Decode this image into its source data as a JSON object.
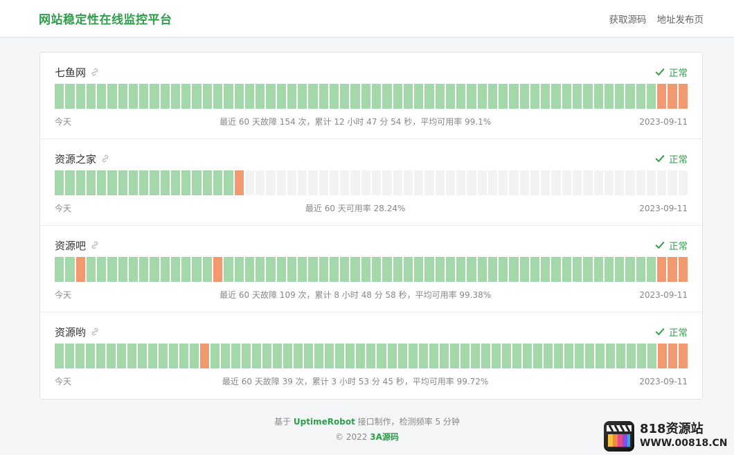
{
  "header": {
    "title": "网站稳定性在线监控平台",
    "nav": [
      "获取源码",
      "地址发布页"
    ]
  },
  "colors": {
    "brand": "#2e9e4a",
    "up": "#a3d8ab",
    "down": "#f2996f",
    "none": "#f2f2f2"
  },
  "monitors": [
    {
      "name": "七鱼网",
      "status": "正常",
      "left_label": "今天",
      "summary": "最近 60 天故障 154 次，累计 12 小时 47 分 54 秒，平均可用率 99.1%",
      "date": "2023-09-11",
      "bars": "uuuuuuuuuuuuuuuuuuuuuuuuuuuuuuuuuuuuuuuuuuuuuuuuuuuuuuuuuddd"
    },
    {
      "name": "资源之家",
      "status": "正常",
      "left_label": "今天",
      "summary": "最近 60 天可用率 28.24%",
      "date": "2023-09-11",
      "bars": "uuuuuuuuuuuuuuuuudnnnnnnnnnnnnnnnnnnnnnnnnnnnnnnnnnnnnnnnnnn"
    },
    {
      "name": "资源吧",
      "status": "正常",
      "left_label": "今天",
      "summary": "最近 60 天故障 109 次，累计 8 小时 48 分 58 秒，平均可用率 99.38%",
      "date": "2023-09-11",
      "bars": "uuduuuuuuuuuuuuduuuuuuuuuuuuuuuuuuuuuuuuuuuuuuuuuuuuuuuuuddd"
    },
    {
      "name": "资源哟",
      "status": "正常",
      "left_label": "今天",
      "summary": "最近 60 天故障 39 次，累计 3 小时 53 分 45 秒，平均可用率 99.72%",
      "date": "2023-09-11",
      "bars": "uuuuuuuuuuuuuuduuuuuuuuuuuuuuuuuuuuuuuuuuuuuuuuuuuuuuuuuuuddd"
    }
  ],
  "footer": {
    "line1_prefix": "基于",
    "line1_brand": "UptimeRobot",
    "line1_suffix": "接口制作，检测频率 5 分钟",
    "line2_prefix": "© 2022",
    "line2_brand": "3A源码"
  },
  "watermark": {
    "title": "818资源站",
    "url": "WWW.00818.CN"
  }
}
